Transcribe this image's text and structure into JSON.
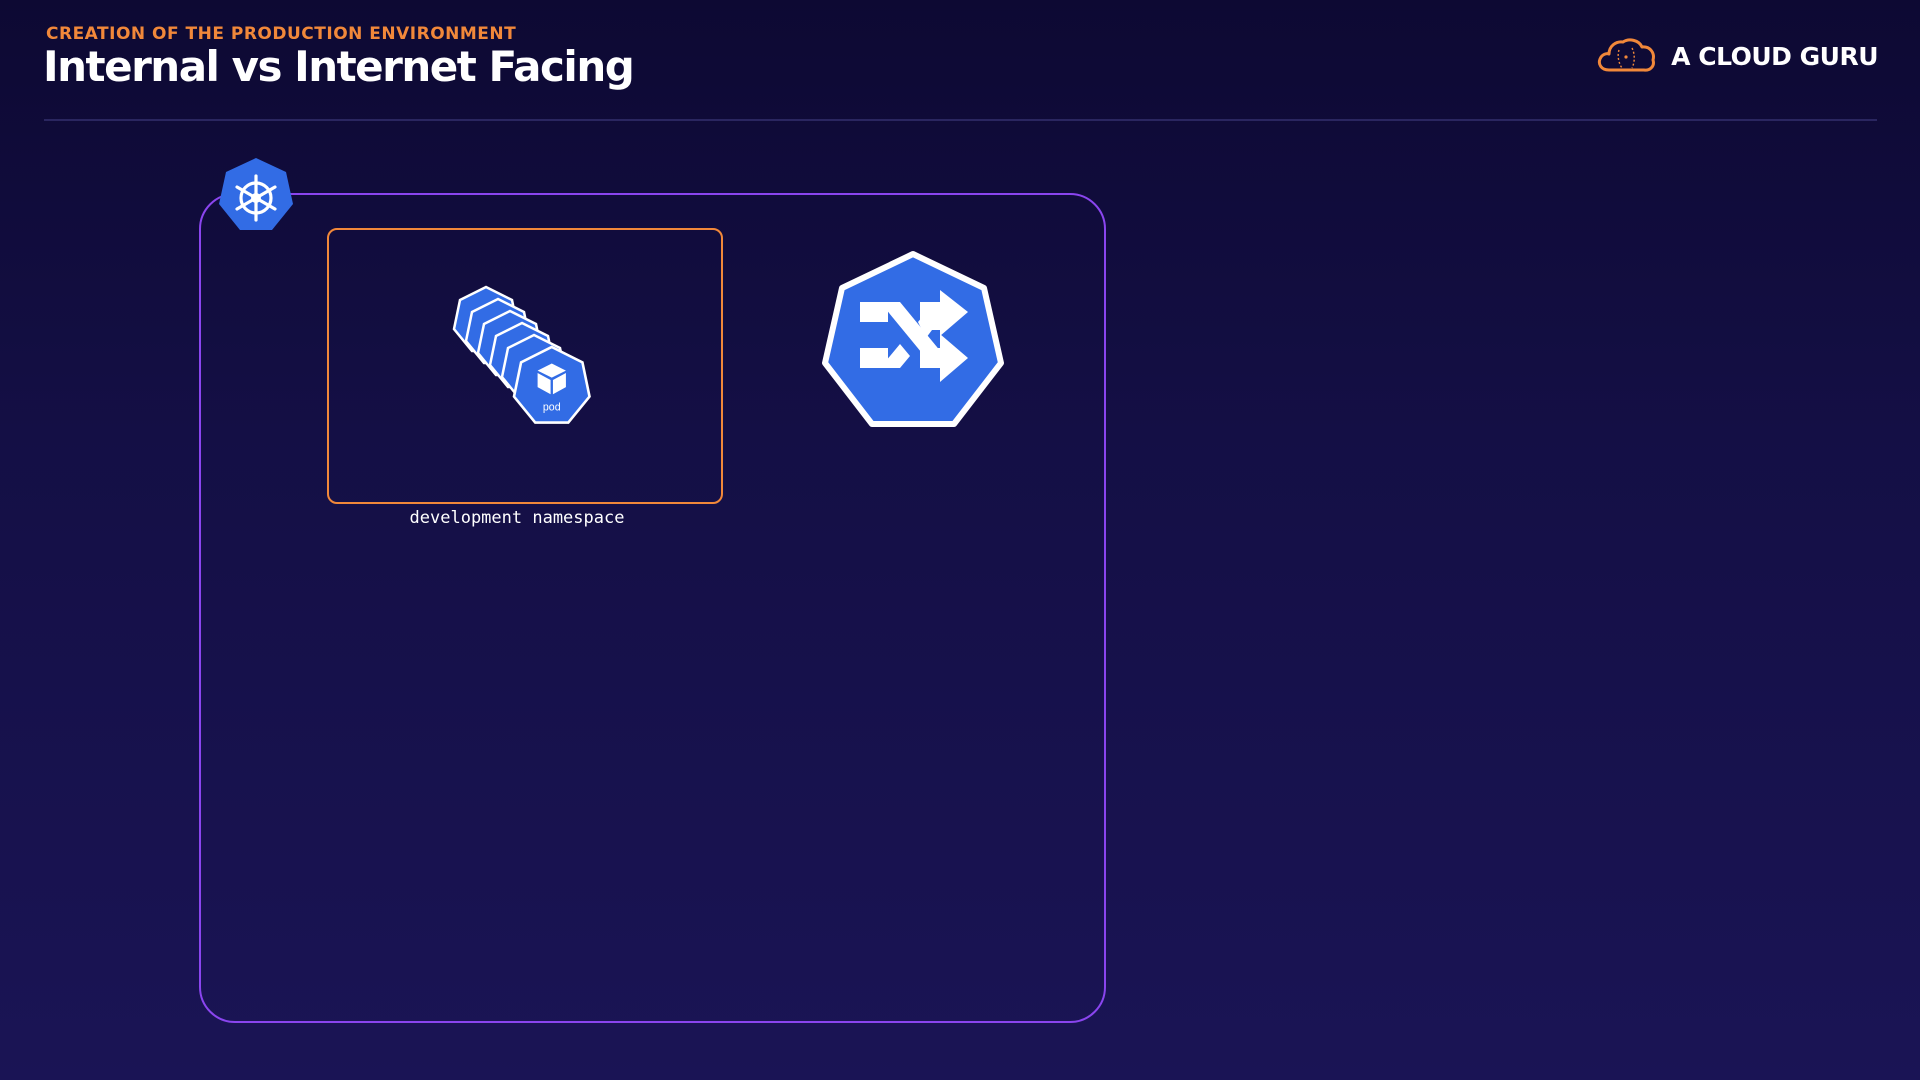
{
  "header": {
    "eyebrow": "CREATION OF THE PRODUCTION ENVIRONMENT",
    "title": "Internal vs Internet Facing"
  },
  "brand": {
    "name": "A CLOUD GURU",
    "icon": "cloud-logo-icon",
    "color": "#f1883a"
  },
  "diagram": {
    "cluster": {
      "icon": "kubernetes-helm-icon",
      "border_color": "#8a45ef"
    },
    "namespace": {
      "label": "development namespace",
      "border_color": "#f1883a"
    },
    "pods": {
      "icon": "pod-icon",
      "label": "pod",
      "stack_count": 6
    },
    "service": {
      "icon": "service-shuffle-icon"
    }
  },
  "colors": {
    "k8s_blue": "#326ce5",
    "accent_orange": "#f1883a",
    "cluster_purple": "#8a45ef"
  }
}
